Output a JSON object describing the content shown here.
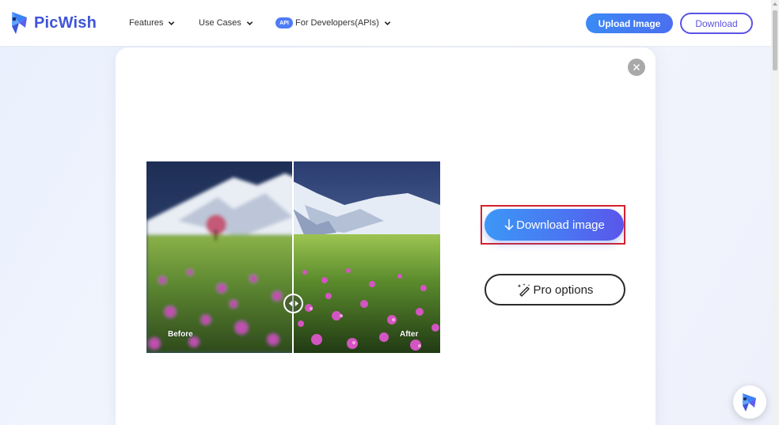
{
  "header": {
    "logo_text": "PicWish",
    "nav": [
      {
        "label": "Features",
        "icon": "chevron-down-icon"
      },
      {
        "label": "Use Cases",
        "icon": "chevron-down-icon"
      },
      {
        "label": "For Developers(APIs)",
        "badge": "API",
        "icon": "chevron-down-icon"
      }
    ],
    "upload_label": "Upload Image",
    "download_label": "Download"
  },
  "modal": {
    "close_icon": "close-icon",
    "comparison": {
      "before_label": "Before",
      "after_label": "After",
      "handle_icon": "compare-arrows-icon"
    },
    "download_image_label": "Download image",
    "download_image_icon": "arrow-down-icon",
    "pro_options_label": "Pro options",
    "pro_options_icon": "magic-wand-icon",
    "highlight_color": "#d8202c"
  },
  "colors": {
    "brand": "#3e54d9",
    "primary_button": "#4285f4",
    "outline_button": "#5b53e6"
  }
}
